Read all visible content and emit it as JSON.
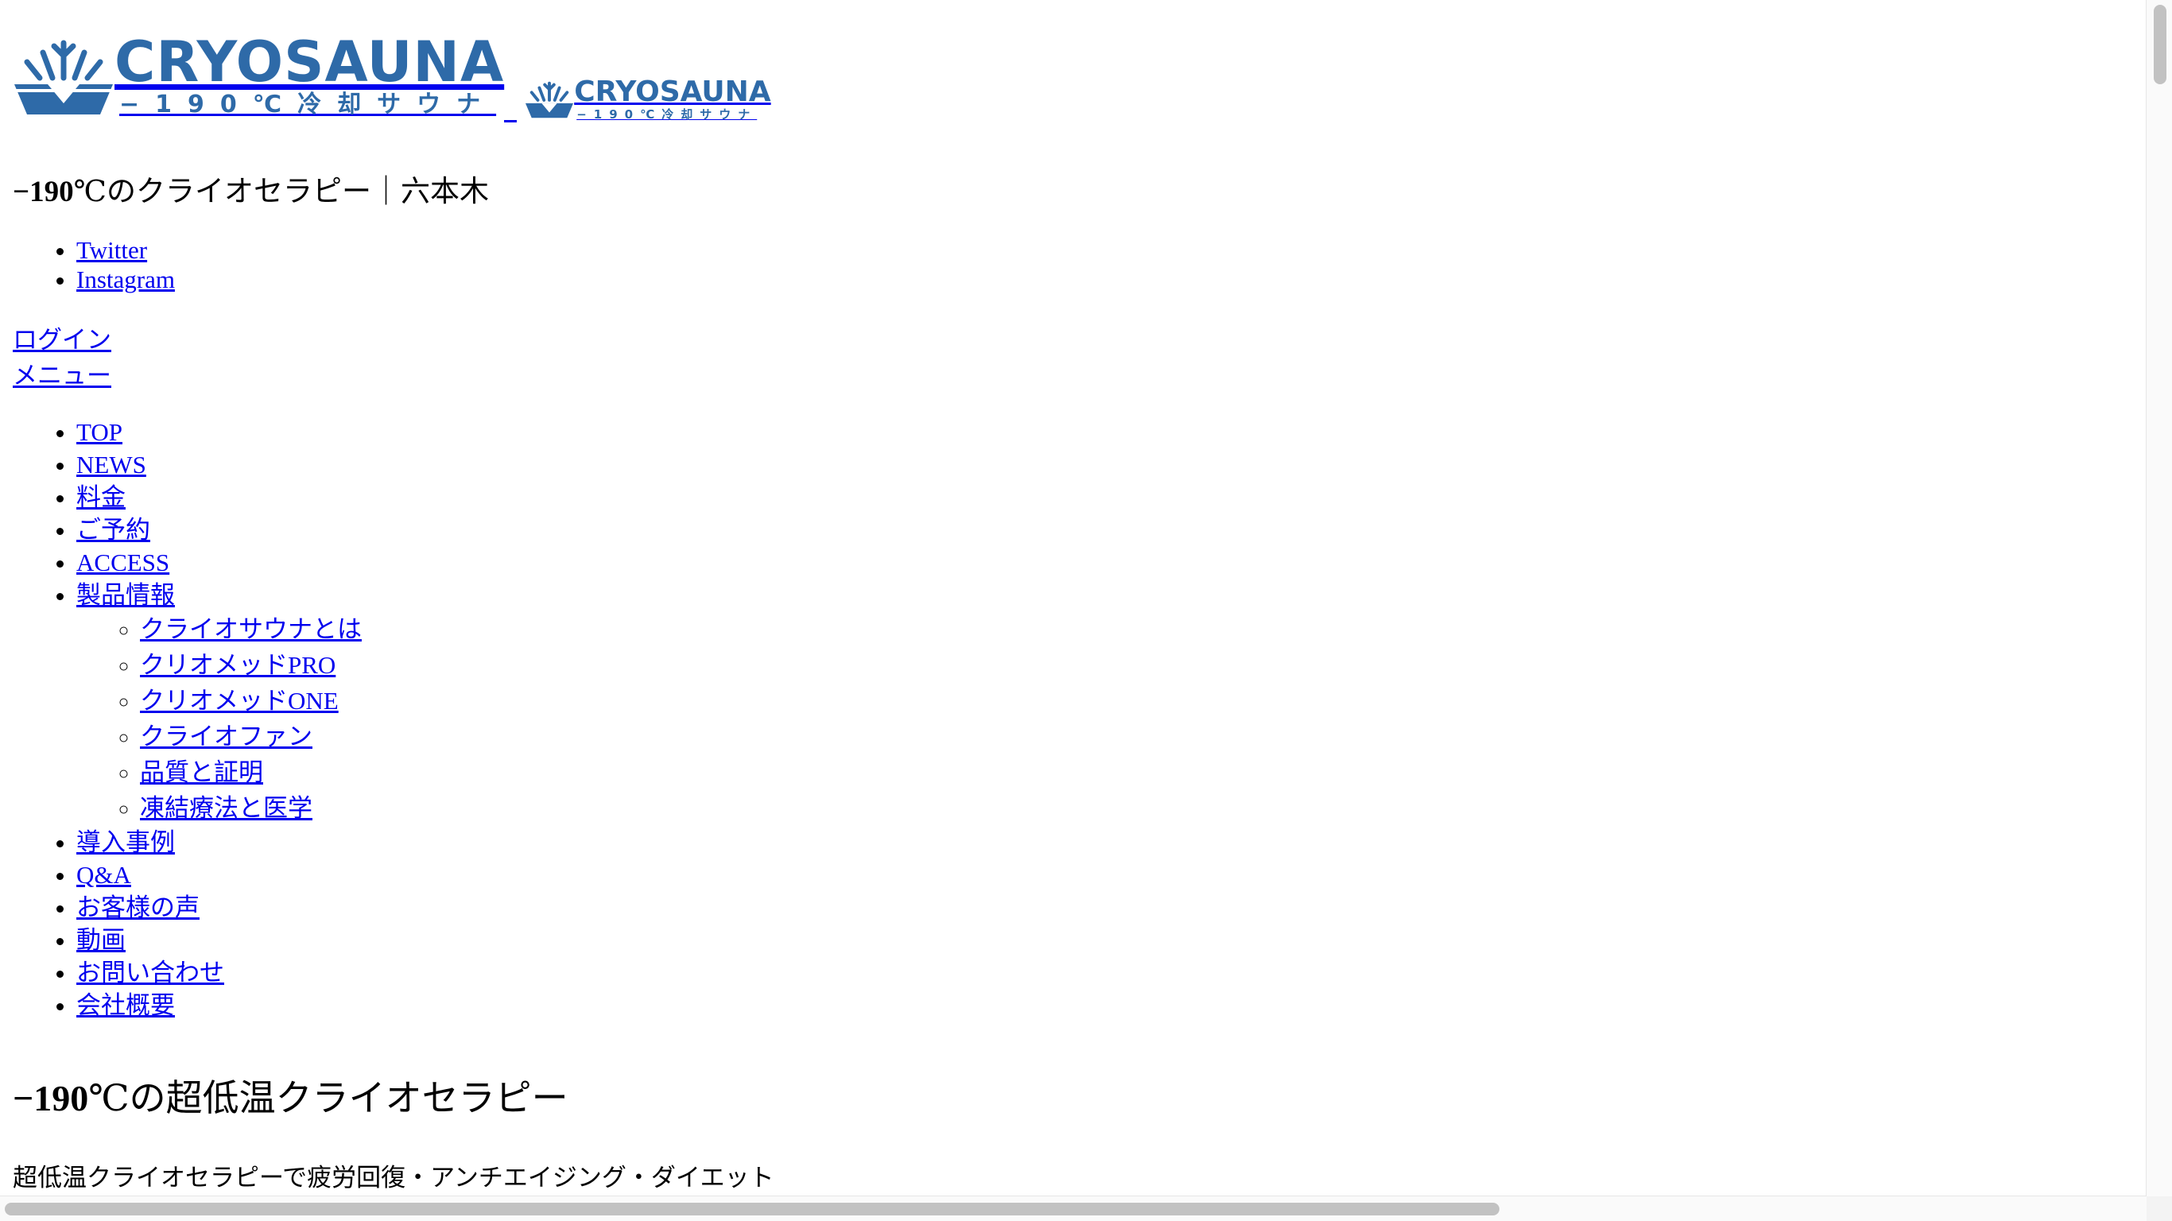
{
  "header": {
    "logo_large": {
      "brand": "CRYOSAUNA",
      "tagline": "−190℃冷却サウナ",
      "registered": "®"
    },
    "logo_small": {
      "brand": "CRYOSAUNA",
      "tagline": "−190℃冷却サウナ",
      "registered": "®"
    },
    "site_title_bold": "−190",
    "site_title_rest": "℃のクライオセラピー｜六本木"
  },
  "social": [
    {
      "label": "Twitter"
    },
    {
      "label": "Instagram"
    }
  ],
  "auth": {
    "login": "ログイン",
    "menu": "メニュー"
  },
  "nav": {
    "items": [
      {
        "label": "TOP"
      },
      {
        "label": "NEWS"
      },
      {
        "label": "料金"
      },
      {
        "label": "ご予約"
      },
      {
        "label": "ACCESS"
      },
      {
        "label": "製品情報"
      },
      {
        "label": "導入事例"
      },
      {
        "label": "Q&A"
      },
      {
        "label": "お客様の声"
      },
      {
        "label": "動画"
      },
      {
        "label": "お問い合わせ"
      },
      {
        "label": "会社概要"
      }
    ],
    "product_sub": [
      {
        "label": "クライオサウナとは"
      },
      {
        "label": "クリオメッドPRO"
      },
      {
        "label": "クリオメッドONE"
      },
      {
        "label": "クライオファン"
      },
      {
        "label": "品質と証明"
      },
      {
        "label": "凍結療法と医学"
      }
    ]
  },
  "hero": {
    "title_bold": "−190",
    "title_rest": "℃の超低温クライオセラピー",
    "subtitle": "超低温クライオセラピーで疲労回復・アンチエイジング・ダイエット"
  },
  "colors": {
    "link": "#0000ee",
    "brand_blue": "#2e6aa8",
    "background": "#ffffff"
  },
  "icons": {
    "logo_mark": "snowflake-sauna-icon"
  }
}
